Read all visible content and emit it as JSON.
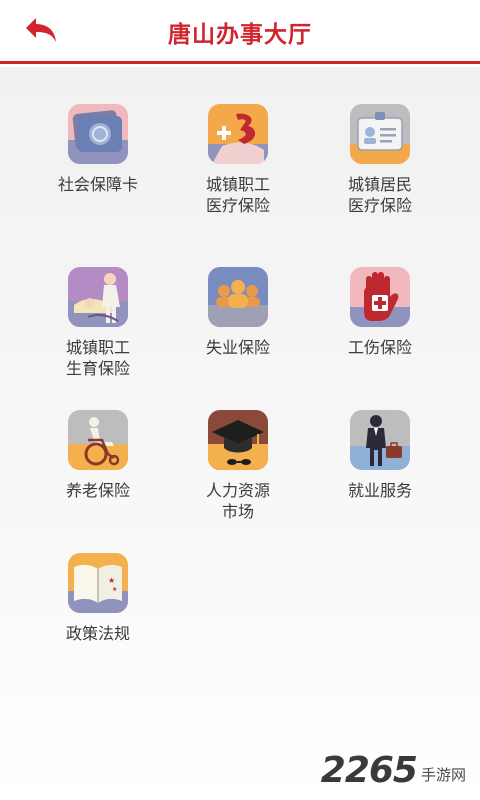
{
  "header": {
    "title": "唐山办事大厅",
    "back_icon": "back-arrow-icon"
  },
  "accent_color": "#d2242c",
  "tiles": [
    {
      "label": "社会保障卡",
      "icon": "social-security-card-icon"
    },
    {
      "label": "城镇职工\n医疗保险",
      "icon": "medical-plus-icon"
    },
    {
      "label": "城镇居民\n医疗保险",
      "icon": "id-badge-icon"
    },
    {
      "label": "城镇职工\n生育保险",
      "icon": "maternity-icon"
    },
    {
      "label": "失业保险",
      "icon": "people-group-icon"
    },
    {
      "label": "工伤保险",
      "icon": "injury-hand-icon"
    },
    {
      "label": "养老保险",
      "icon": "wheelchair-icon"
    },
    {
      "label": "人力资源\n市场",
      "icon": "graduation-cap-icon"
    },
    {
      "label": "就业服务",
      "icon": "businessman-icon"
    },
    {
      "label": "政策法规",
      "icon": "open-book-icon"
    }
  ],
  "watermark": {
    "number": "2265",
    "text": "手游网"
  }
}
